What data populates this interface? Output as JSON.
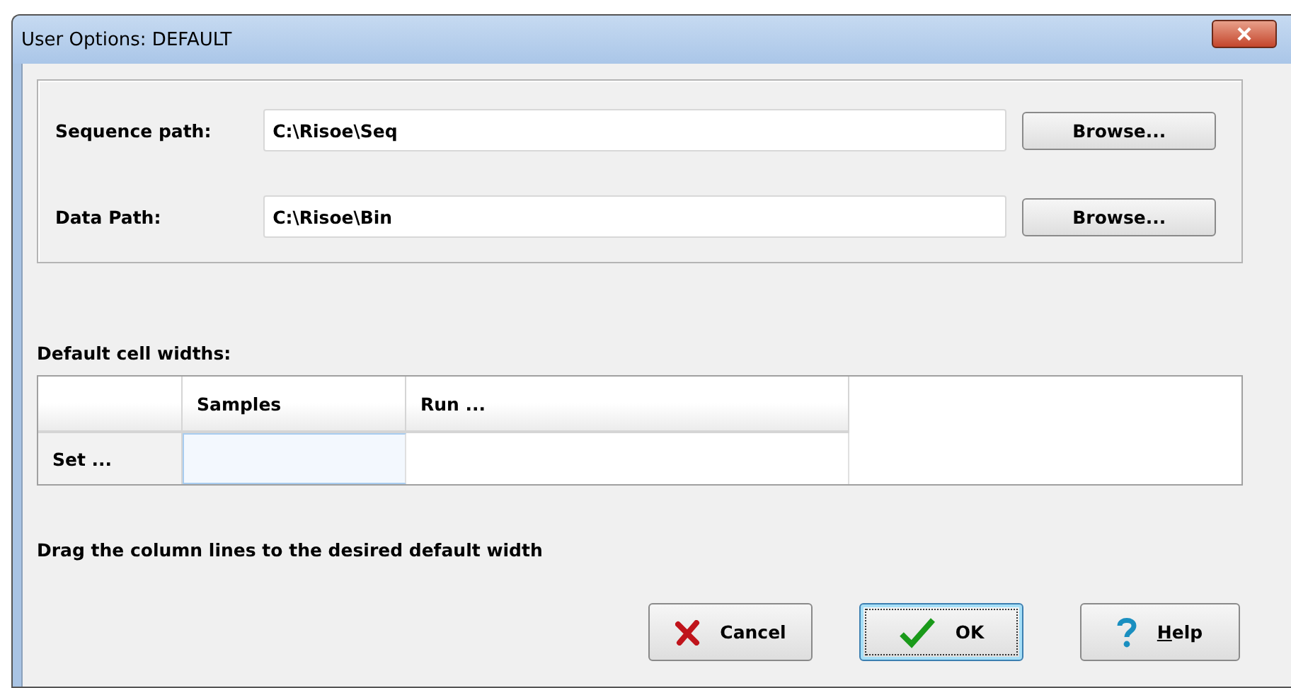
{
  "window": {
    "title": "User Options: DEFAULT"
  },
  "paths": [
    {
      "label": "Sequence path:",
      "value": "C:\\Risoe\\Seq",
      "button": "Browse..."
    },
    {
      "label": "Data Path:",
      "value": "C:\\Risoe\\Bin",
      "button": "Browse..."
    }
  ],
  "grid": {
    "title": "Default cell widths:",
    "columns": [
      "Samples",
      "Run ..."
    ],
    "rows": [
      {
        "header": "Set ...",
        "cells": [
          {
            "selected": true
          },
          {
            "selected": false
          }
        ]
      }
    ]
  },
  "hint": "Drag the column lines to the desired default width",
  "buttons": [
    {
      "kind": "cancel",
      "label": "Cancel",
      "focused": false
    },
    {
      "kind": "ok",
      "label": "OK",
      "focused": true
    },
    {
      "kind": "help",
      "mnemonic": "H",
      "label": "elp",
      "focused": false
    }
  ]
}
